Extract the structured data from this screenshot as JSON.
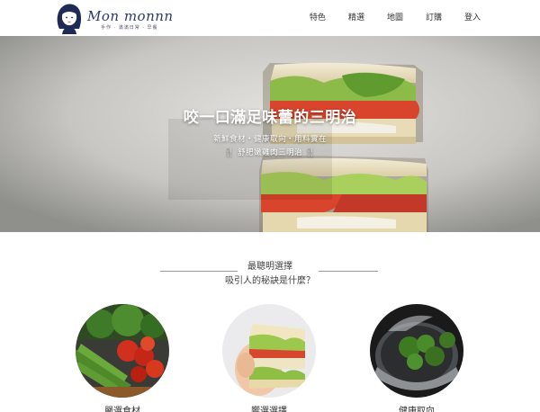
{
  "header": {
    "logo_title": "Mon monnn",
    "logo_tagline": "手作 · 滿滿日常 · 早餐",
    "nav": [
      {
        "label": "特色"
      },
      {
        "label": "精選"
      },
      {
        "label": "地圖"
      },
      {
        "label": "訂購"
      },
      {
        "label": "登入"
      }
    ]
  },
  "hero": {
    "title": "咬一口滿足味蕾的三明治",
    "subtitle": "新鮮食材・健康取向・用料實在",
    "brand": "舒肥嫩雞肉三明治",
    "fork_glyph": "🍴"
  },
  "section": {
    "title": "最聰明選擇",
    "subtitle": "吸引人的秘訣是什麼？"
  },
  "features": [
    {
      "label": "嚴選食材",
      "image": "vegetables-image"
    },
    {
      "label": "饗選選擇",
      "image": "sandwich-image"
    },
    {
      "label": "健康取向",
      "image": "broccoli-pot-image"
    }
  ],
  "colors": {
    "logo_navy": "#2a3a6a",
    "nav_text": "#333333",
    "hero_text": "#ffffff",
    "divider": "#9a9a9a"
  }
}
